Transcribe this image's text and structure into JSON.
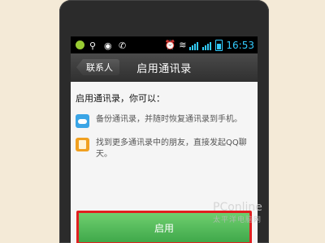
{
  "status_bar": {
    "time": "16:53"
  },
  "header": {
    "back_label": "联系人",
    "title": "启用通讯录"
  },
  "content": {
    "intro": "启用通讯录，你可以：",
    "features": [
      {
        "icon": "cloud-backup-icon",
        "text": "备份通讯录，并随时恢复通讯录到手机。"
      },
      {
        "icon": "address-book-icon",
        "text": "找到更多通讯录中的朋友，直接发起QQ聊天。"
      }
    ]
  },
  "primary_action": {
    "label": "启用",
    "highlight_color": "#e02020",
    "button_color": "#4cb853"
  },
  "watermark": {
    "brand": "PConline",
    "sub": "太平洋电脑网"
  }
}
